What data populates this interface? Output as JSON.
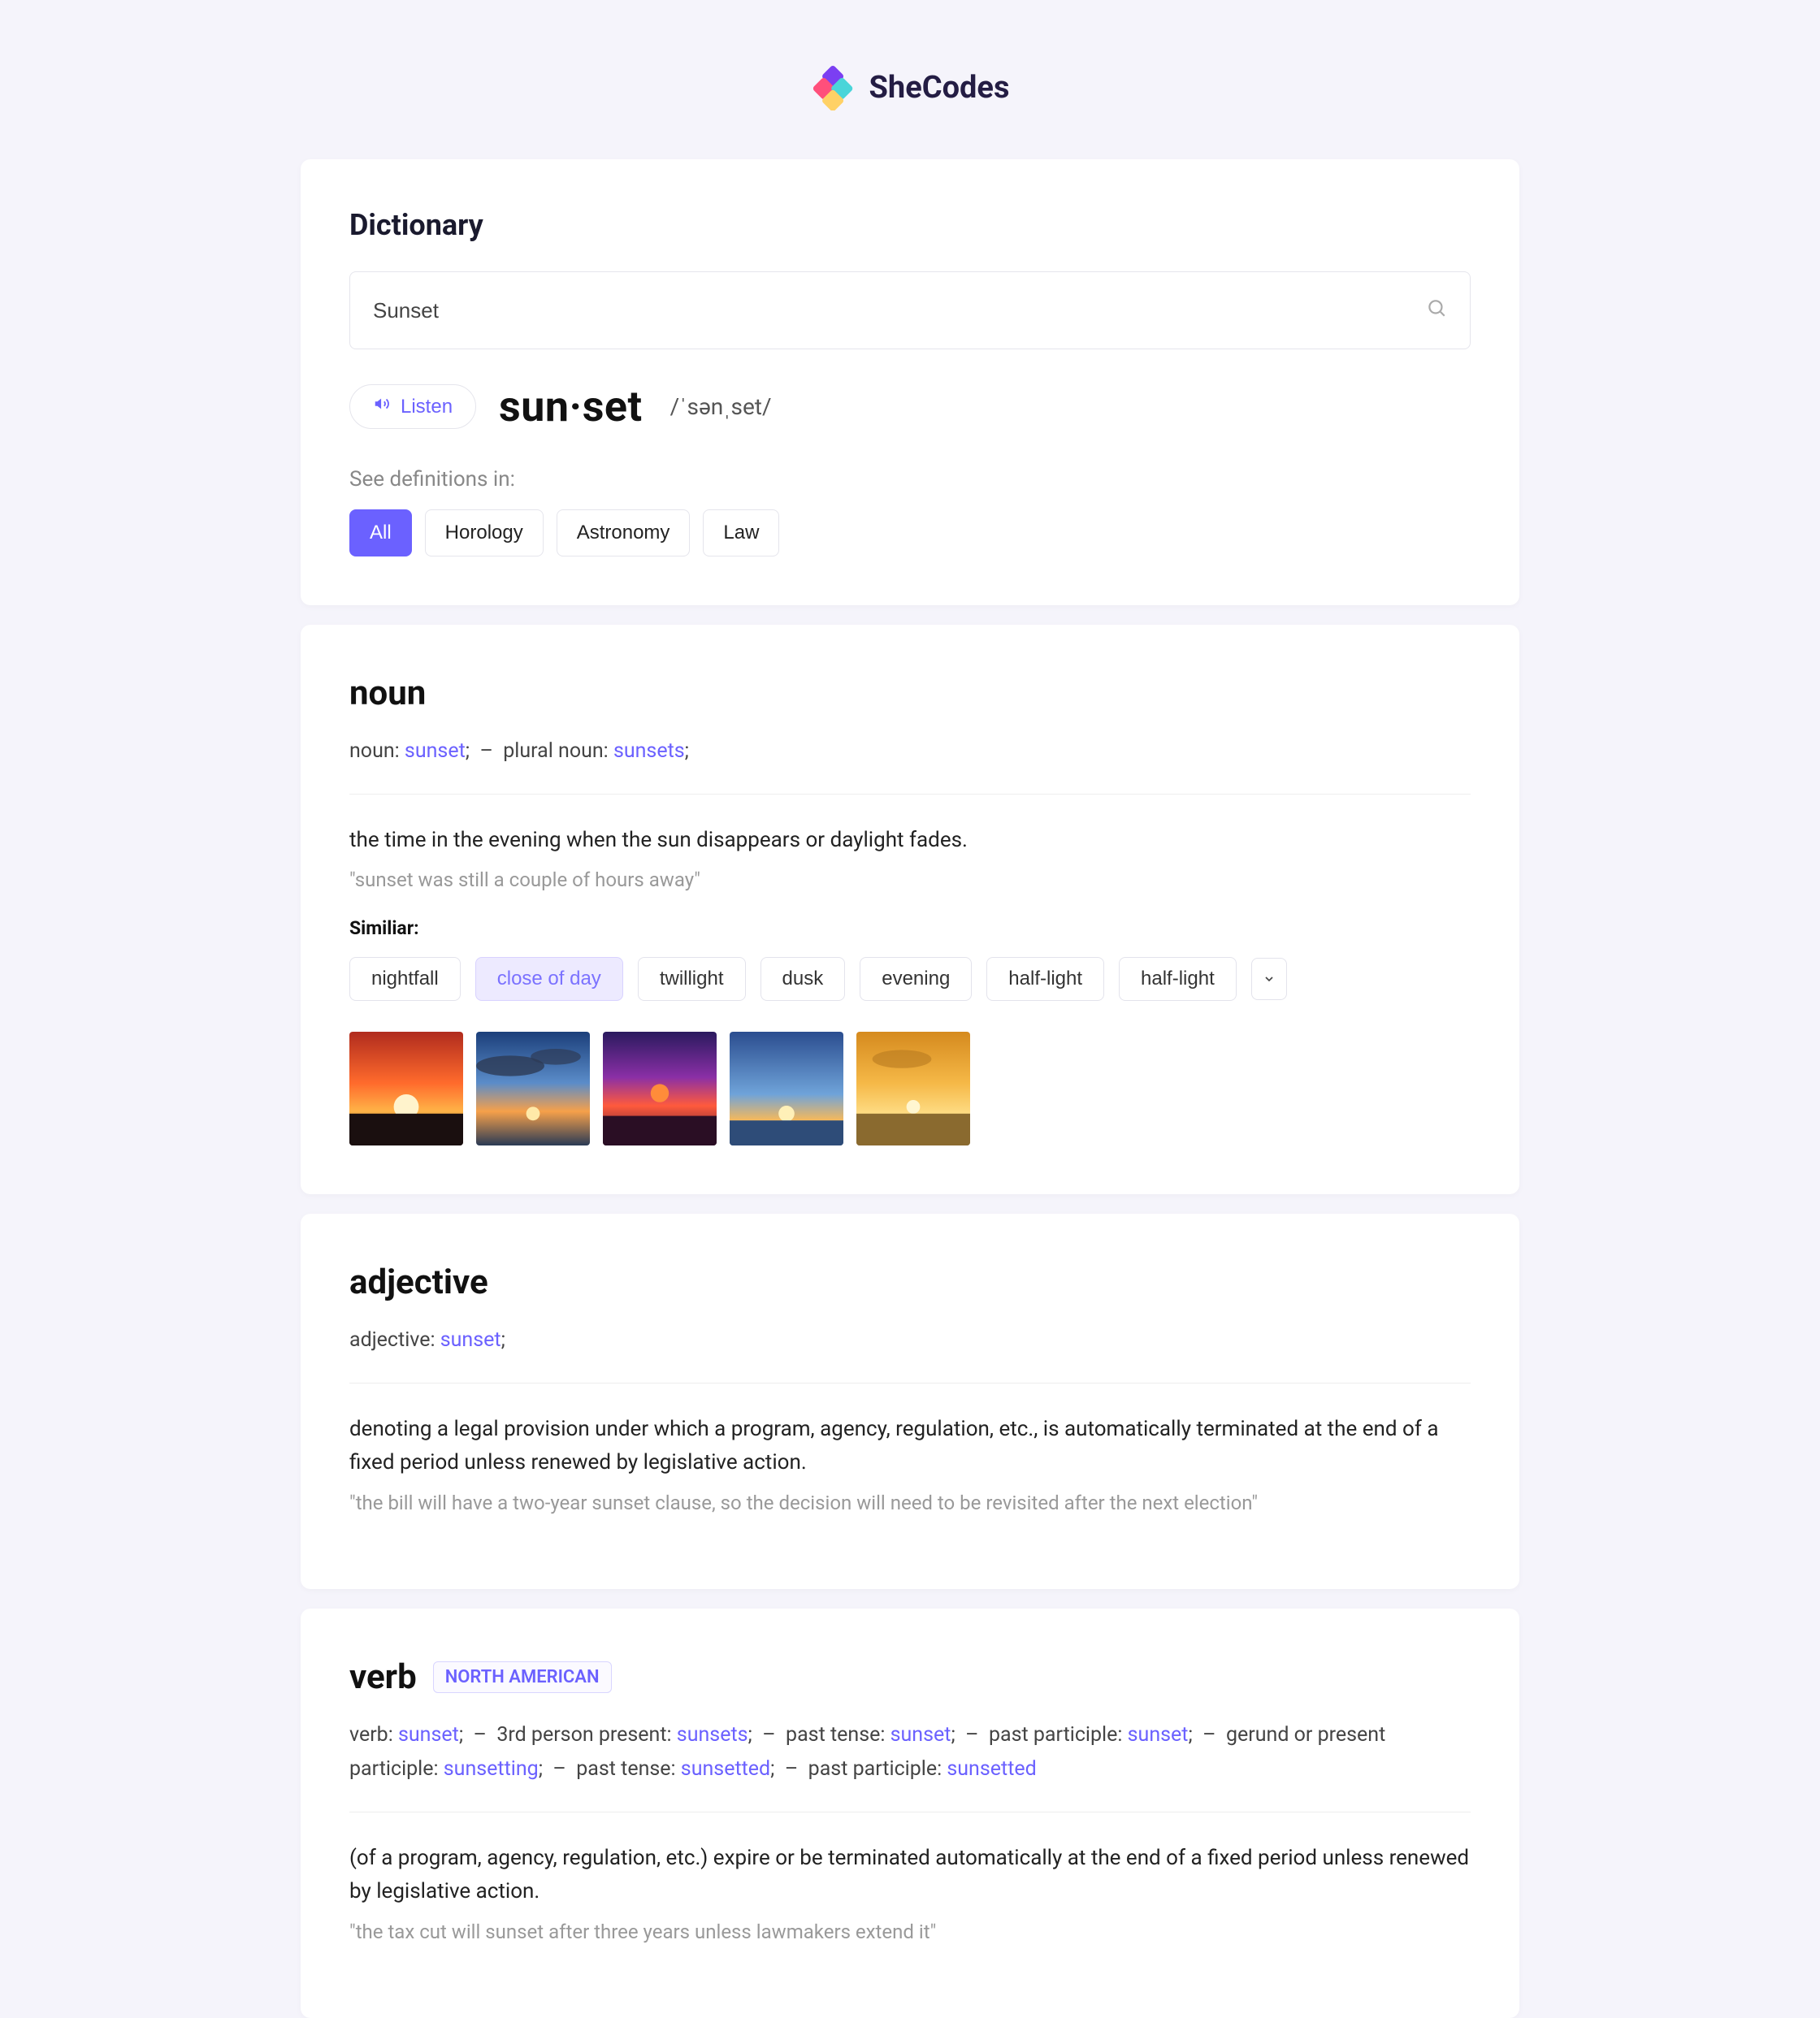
{
  "brand": {
    "name": "SheCodes"
  },
  "dictionary": {
    "title": "Dictionary",
    "search_value": "Sunset",
    "listen_label": "Listen",
    "headword": "sun·set",
    "phonetic": "/ˈsənˌset/",
    "see_definitions_label": "See definitions in:",
    "categories": [
      "All",
      "Horology",
      "Astronomy",
      "Law"
    ],
    "active_category": "All"
  },
  "noun": {
    "pos": "noun",
    "forms_html": "noun: <span class='blue'>sunset</span>;  –  plural noun: <span class='blue'>sunsets</span>;",
    "definition": "the time in the evening when the sun disappears or daylight fades.",
    "example": "\"sunset was still a couple of hours away\"",
    "similar_label": "Similiar:",
    "similar": [
      "nightfall",
      "close of day",
      "twillight",
      "dusk",
      "evening",
      "half-light",
      "half-light"
    ],
    "highlighted_similar": "close of day"
  },
  "adjective": {
    "pos": "adjective",
    "forms_html": "adjective: <span class='blue'>sunset</span>;",
    "definition": "denoting a legal provision under which a program, agency, regulation, etc., is automatically terminated at the end of a fixed period unless renewed by legislative action.",
    "example": "\"the bill will have a two-year sunset clause, so the decision will need to be revisited after the next election\""
  },
  "verb": {
    "pos": "verb",
    "region": "NORTH AMERICAN",
    "forms_html": "verb: <span class='blue'>sunset</span>;  –  3rd person present: <span class='blue'>sunsets</span>;  –  past tense: <span class='blue'>sunset</span>;  –  past participle: <span class='blue'>sunset</span>;  –  gerund or present participle: <span class='blue'>sunsetting</span>;  –  past tense: <span class='blue'>sunsetted</span>;  –  past participle: <span class='blue'>sunsetted</span>",
    "definition": "(of a program, agency, regulation, etc.) expire or be terminated automatically at the end of a fixed period unless renewed by legislative action.",
    "example": "\"the tax cut will sunset after three years unless lawmakers extend it\""
  }
}
